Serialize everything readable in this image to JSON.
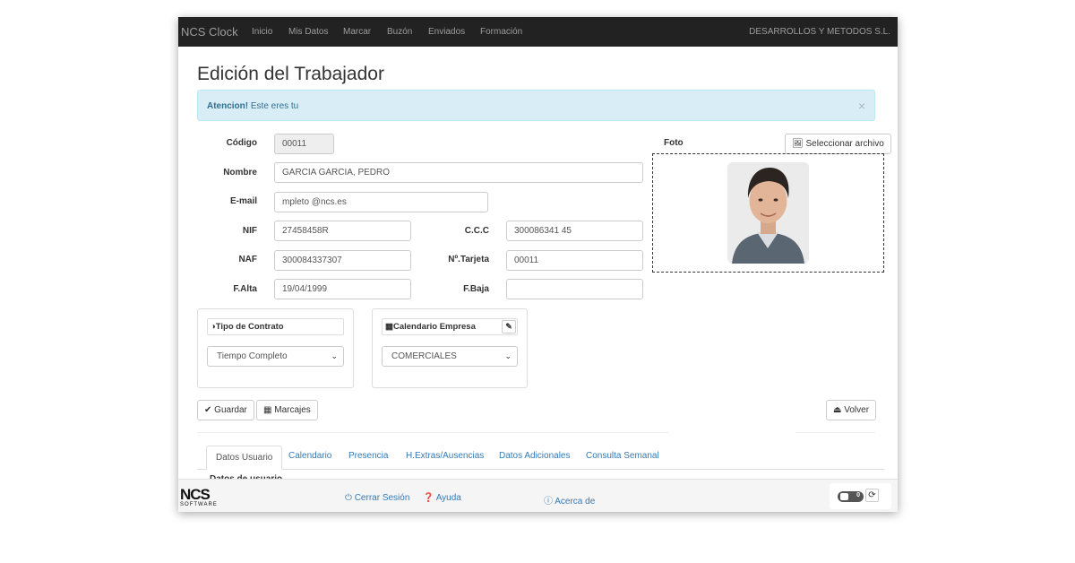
{
  "navbar": {
    "brand": "NCS Clock",
    "items": [
      "Inicio",
      "Mis Datos",
      "Marcar",
      "Buzón",
      "Enviados",
      "Formación"
    ],
    "company": "DESARROLLOS Y METODOS S.L."
  },
  "page_title": "Edición del Trabajador",
  "alert": {
    "strong": "Atencion!",
    "text": " Este eres tu",
    "close": "×"
  },
  "form": {
    "codigo_label": "Código",
    "codigo_value": "00011",
    "nombre_label": "Nombre",
    "nombre_value": "GARCIA GARCIA, PEDRO",
    "email_label": "E-mail",
    "email_value": "mpleto @ncs.es",
    "nif_label": "NIF",
    "nif_value": "27458458R",
    "ccc_label": "C.C.C",
    "ccc_value": "300086341  45",
    "naf_label": "NAF",
    "naf_value": "300084337307",
    "tarjeta_label": "Nº.Tarjeta",
    "tarjeta_value": "00011",
    "alta_label": "F.Alta",
    "alta_value": "19/04/1999",
    "baja_label": "F.Baja",
    "baja_value": ""
  },
  "foto": {
    "label": "Foto",
    "select_button": "Seleccionar archivo"
  },
  "contrato": {
    "title": "Tipo de Contrato",
    "selected": "Tiempo Completo"
  },
  "calendario": {
    "title": "Calendario Empresa",
    "selected": "COMERCIALES"
  },
  "buttons": {
    "guardar": "Guardar",
    "marcajes": "Marcajes",
    "volver": "Volver"
  },
  "tabs": [
    "Datos Usuario",
    "Calendario",
    "Presencia",
    "H.Extras/Ausencias",
    "Datos Adicionales",
    "Consulta Semanal"
  ],
  "partial_heading": "Datos de usuario",
  "footer": {
    "logo_big": "NCS",
    "logo_small": "SOFTWARE",
    "cerrar": "Cerrar Sesión",
    "ayuda": "Ayuda",
    "acerca": "Acerca de",
    "toggle_value": "0"
  },
  "icons": {
    "image": "image-icon",
    "contrast": "contrast-icon",
    "calendar": "calendar-icon",
    "pencil": "pencil-icon",
    "check": "check-icon",
    "eject": "eject-icon",
    "power": "power-icon",
    "question": "question-icon",
    "info": "info-icon",
    "refresh": "refresh-icon"
  },
  "colors": {
    "navbar": "#222222",
    "alert_bg": "#d9edf7",
    "link": "#337ab7"
  }
}
